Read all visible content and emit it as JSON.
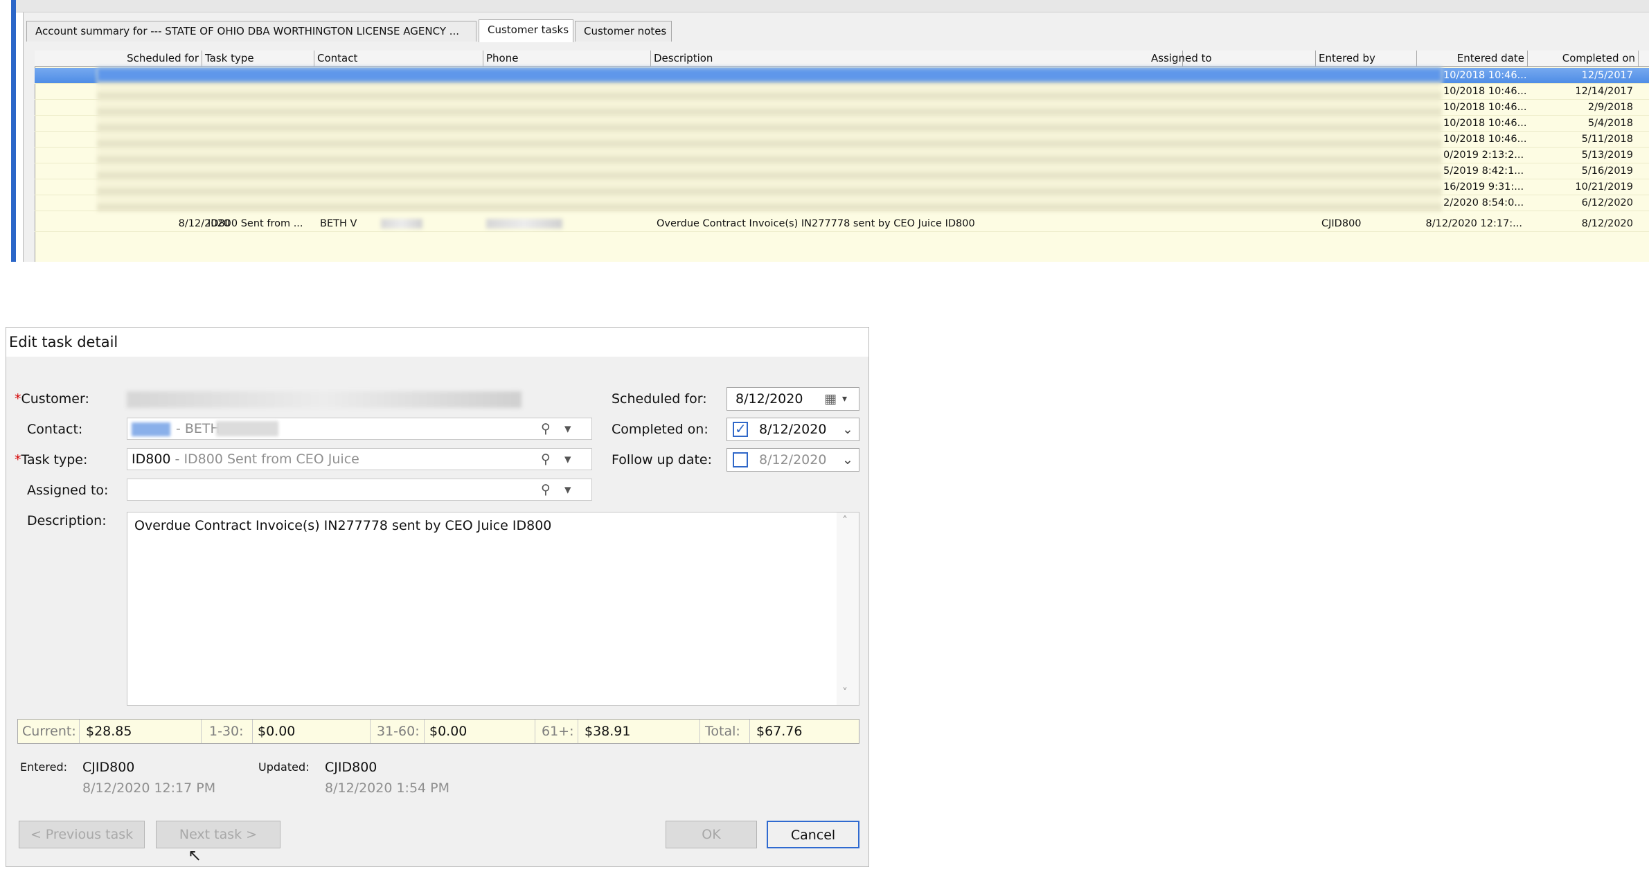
{
  "tabs": [
    {
      "label": "Account summary for ---    STATE OF OHIO DBA WORTHINGTON LICENSE AGENCY ..."
    },
    {
      "label": "Customer tasks"
    },
    {
      "label": "Customer notes"
    }
  ],
  "grid": {
    "columns": [
      "Scheduled for",
      "Task type",
      "Contact",
      "Phone",
      "Description",
      "Assigned to",
      "Entered by",
      "Entered date",
      "Completed on"
    ],
    "rows": [
      {
        "entered_date": "10/2018 10:46...",
        "completed_on": "12/5/2017"
      },
      {
        "entered_date": "10/2018 10:46...",
        "completed_on": "12/14/2017"
      },
      {
        "entered_date": "10/2018 10:46...",
        "completed_on": "2/9/2018"
      },
      {
        "entered_date": "10/2018 10:46...",
        "completed_on": "5/4/2018"
      },
      {
        "entered_date": "10/2018 10:46...",
        "completed_on": "5/11/2018"
      },
      {
        "entered_date": "0/2019 2:13:2...",
        "completed_on": "5/13/2019"
      },
      {
        "entered_date": "5/2019 8:42:1...",
        "completed_on": "5/16/2019"
      },
      {
        "entered_date": "16/2019 9:31:...",
        "completed_on": "10/21/2019"
      },
      {
        "entered_date": "2/2020 8:54:0...",
        "completed_on": "6/12/2020"
      }
    ],
    "last_row": {
      "scheduled_for": "8/12/2020",
      "task_type": "ID800 Sent from ...",
      "contact": "BETH V",
      "description": "Overdue Contract Invoice(s) IN277778 sent by CEO Juice ID800",
      "entered_by": "CJID800",
      "entered_date": "8/12/2020 12:17:...",
      "completed_on": "8/12/2020"
    }
  },
  "dialog": {
    "title": "Edit task detail",
    "close_glyph": "✕",
    "required_mark": "*",
    "labels": {
      "customer": "Customer:",
      "contact": "Contact:",
      "task_type": "Task type:",
      "assigned_to": "Assigned to:",
      "description": "Description:",
      "scheduled_for": "Scheduled for:",
      "completed_on": "Completed on:",
      "follow_up_date": "Follow up date:",
      "entered": "Entered:",
      "updated": "Updated:"
    },
    "contact_value": "- BETH",
    "task_type_code": "ID800",
    "task_type_desc": "- ID800 Sent from CEO Juice",
    "assigned_to_value": "",
    "description_value": "Overdue Contract Invoice(s) IN277778 sent by CEO Juice ID800",
    "scheduled_for_value": "8/12/2020",
    "completed_on_value": "8/12/2020",
    "completed_checked": true,
    "follow_up_value": "8/12/2020",
    "follow_up_checked": false,
    "aging": [
      {
        "label": "Current:",
        "value": "$28.85"
      },
      {
        "label": "1-30:",
        "value": "$0.00"
      },
      {
        "label": "31-60:",
        "value": "$0.00"
      },
      {
        "label": "61+:",
        "value": "$38.91"
      },
      {
        "label": "Total:",
        "value": "$67.76"
      }
    ],
    "entered_by": "CJID800",
    "entered_at": "8/12/2020 12:17 PM",
    "updated_by": "CJID800",
    "updated_at": "8/12/2020 1:54 PM",
    "buttons": {
      "previous": "< Previous task",
      "next": "Next task >",
      "ok": "OK",
      "cancel": "Cancel"
    }
  },
  "icons": {
    "search": "⚲",
    "lookup": "▾",
    "calendar": "▦",
    "dropdown": "⌄",
    "check": "✓",
    "scroll_up": "˄",
    "scroll_down": "˅",
    "cursor": "↖"
  },
  "colors": {
    "selection": "#5f97ea",
    "grid_background": "#fdfce3",
    "checkbox_border": "#2f67c8",
    "required": "#d40000"
  }
}
